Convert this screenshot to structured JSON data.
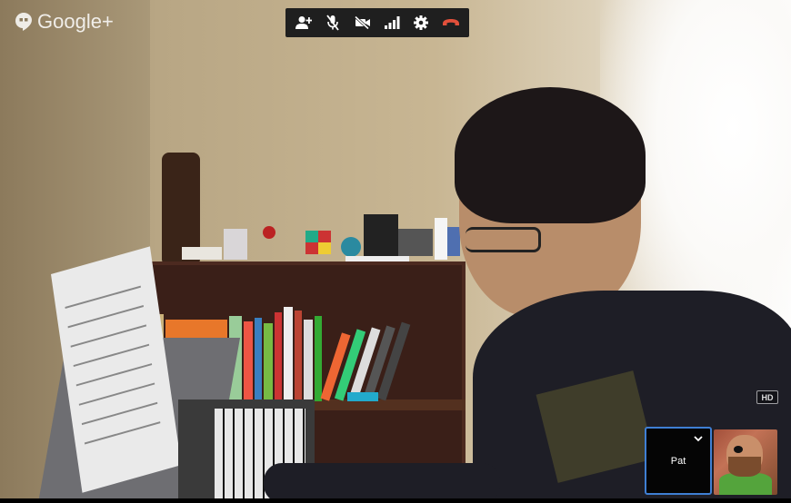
{
  "app": {
    "brand_text": "Google+"
  },
  "toolbar": {
    "buttons": [
      {
        "name": "invite-people",
        "icon": "add-person-icon"
      },
      {
        "name": "mute-microphone",
        "icon": "mic-muted-icon"
      },
      {
        "name": "turn-off-camera",
        "icon": "camera-off-icon"
      },
      {
        "name": "bandwidth",
        "icon": "signal-bars-icon"
      },
      {
        "name": "settings",
        "icon": "gear-icon"
      },
      {
        "name": "hang-up",
        "icon": "hang-up-icon"
      }
    ],
    "hangup_color": "#e2503b",
    "icon_color": "#ffffff"
  },
  "video": {
    "quality_badge": "HD"
  },
  "participants": {
    "self": {
      "name": "Pat",
      "selected": true,
      "border_color": "#3f7fd4"
    },
    "other": {
      "avatar": "bearded-man-eyepatch"
    }
  }
}
